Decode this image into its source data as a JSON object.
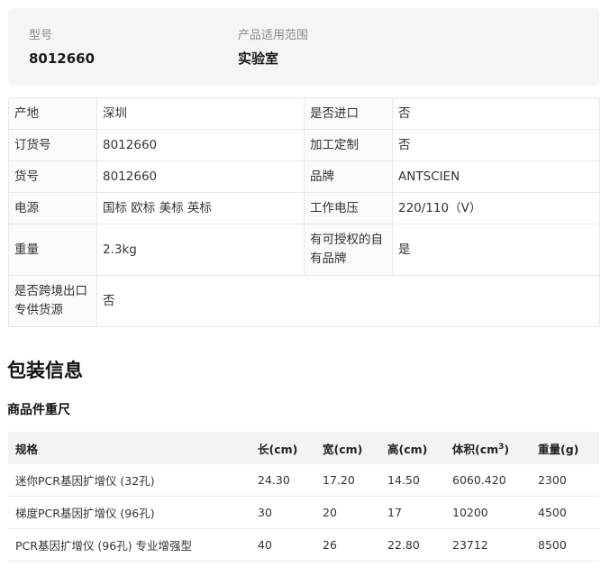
{
  "summary": {
    "model_label": "型号",
    "model_value": "8012660",
    "scope_label": "产品适用范围",
    "scope_value": "实验室"
  },
  "attributes": [
    [
      {
        "k": "产地",
        "v": "深圳"
      },
      {
        "k": "是否进口",
        "v": "否"
      }
    ],
    [
      {
        "k": "订货号",
        "v": "8012660"
      },
      {
        "k": "加工定制",
        "v": "否"
      }
    ],
    [
      {
        "k": "货号",
        "v": "8012660"
      },
      {
        "k": "品牌",
        "v": "ANTSCIEN"
      }
    ],
    [
      {
        "k": "电源",
        "v": "国标 欧标 美标 英标"
      },
      {
        "k": "工作电压",
        "v": "220/110（V）"
      }
    ],
    [
      {
        "k": "重量",
        "v": "2.3kg"
      },
      {
        "k": "有可授权的自有品牌",
        "v": "是"
      }
    ],
    [
      {
        "k": "是否跨境出口专供货源",
        "v": "否"
      }
    ]
  ],
  "packaging": {
    "title": "包装信息",
    "subtitle": "商品件重尺",
    "headers": {
      "spec": "规格",
      "length": "长(cm)",
      "width": "宽(cm)",
      "height": "高(cm)",
      "volume": "体积(cm",
      "volume_sup": "3",
      "volume_end": ")",
      "weight": "重量(g)"
    },
    "rows": [
      {
        "spec": "迷你PCR基因扩增仪 (32孔)",
        "length": "24.30",
        "width": "17.20",
        "height": "14.50",
        "volume": "6060.420",
        "weight": "2300"
      },
      {
        "spec": "梯度PCR基因扩增仪 (96孔)",
        "length": "30",
        "width": "20",
        "height": "17",
        "volume": "10200",
        "weight": "4500"
      },
      {
        "spec": "PCR基因扩增仪 (96孔) 专业增强型",
        "length": "40",
        "width": "26",
        "height": "22.80",
        "volume": "23712",
        "weight": "8500"
      }
    ]
  }
}
